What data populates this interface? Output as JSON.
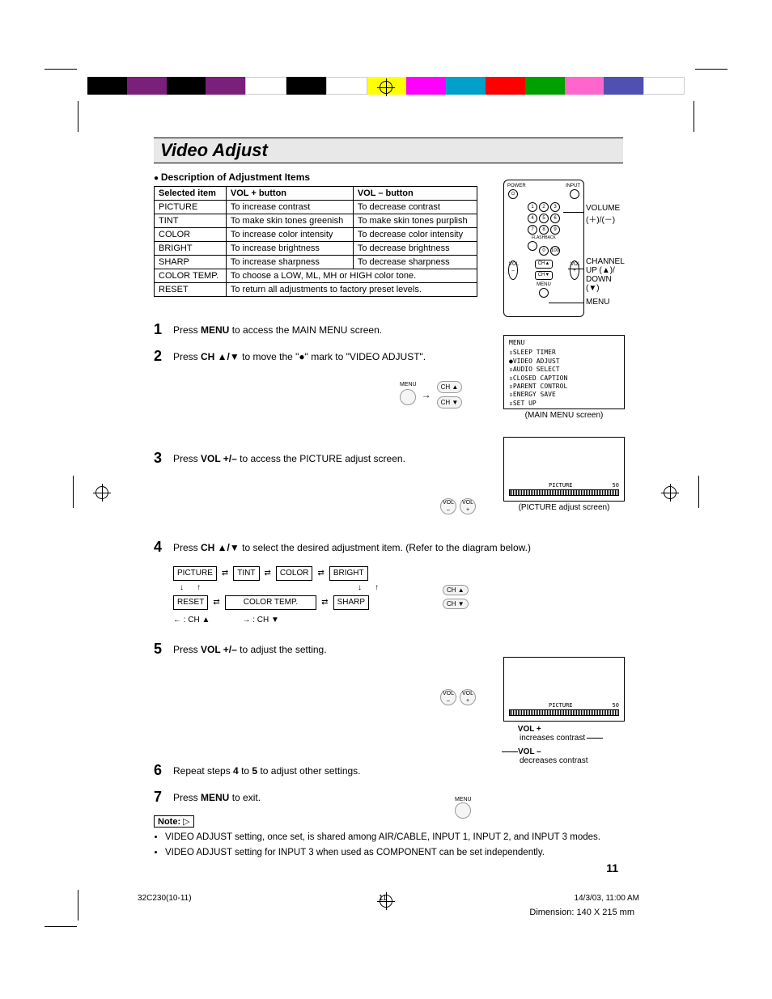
{
  "title": "Video Adjust",
  "subhead": "Description of Adjustment Items",
  "table": {
    "headers": [
      "Selected item",
      "VOL + button",
      "VOL – button"
    ],
    "rows": [
      [
        "PICTURE",
        "To increase contrast",
        "To decrease contrast"
      ],
      [
        "TINT",
        "To make skin tones greenish",
        "To make skin tones purplish"
      ],
      [
        "COLOR",
        "To increase color intensity",
        "To decrease color intensity"
      ],
      [
        "BRIGHT",
        "To increase brightness",
        "To decrease brightness"
      ],
      [
        "SHARP",
        "To increase sharpness",
        "To decrease sharpness"
      ]
    ],
    "span_rows": [
      [
        "COLOR TEMP.",
        "To choose a LOW, ML, MH or HIGH color tone."
      ],
      [
        "RESET",
        "To return all adjustments to factory preset levels."
      ]
    ]
  },
  "remote_labels": {
    "volume": "VOLUME\n(＋)/(－)",
    "channel": "CHANNEL\nUP (▲)/\nDOWN (▼)",
    "menu": "MENU",
    "power": "POWER",
    "input": "INPUT",
    "flashback": "FLASHBACK"
  },
  "steps": {
    "s1_a": "Press ",
    "s1_b": "MENU",
    "s1_c": " to access the MAIN MENU screen.",
    "s2_a": "Press ",
    "s2_b": "CH ▲/▼",
    "s2_c": " to move the \"●\" mark to \"VIDEO ADJUST\".",
    "s3_a": "Press ",
    "s3_b": "VOL +/–",
    "s3_c": " to access the PICTURE adjust screen.",
    "s4_a": "Press ",
    "s4_b": "CH ▲/▼",
    "s4_c": " to select the desired adjustment item. (Refer to the diagram below.)",
    "s5_a": "Press ",
    "s5_b": "VOL +/–",
    "s5_c": " to adjust the setting.",
    "s6_a": "Repeat steps ",
    "s6_b": "4",
    "s6_c": " to ",
    "s6_d": "5",
    "s6_e": " to adjust other settings.",
    "s7_a": "Press ",
    "s7_b": "MENU",
    "s7_c": " to exit."
  },
  "menu_screen": {
    "title": "MENU",
    "items": [
      "SLEEP TIMER",
      "VIDEO ADJUST",
      "AUDIO SELECT",
      "CLOSED CAPTION",
      "PARENT CONTROL",
      "ENERGY SAVE",
      "SET UP"
    ],
    "caption": "(MAIN MENU screen)"
  },
  "picture_screen": {
    "label": "PICTURE",
    "value": "50",
    "caption": "(PICTURE adjust screen)"
  },
  "flow": {
    "row1": [
      "PICTURE",
      "TINT",
      "COLOR",
      "BRIGHT"
    ],
    "row2_left": "RESET",
    "row2_mid": "COLOR TEMP.",
    "row2_right": "SHARP",
    "legend_left": "← : CH ▲",
    "legend_right": "→ : CH ▼"
  },
  "adjust_labels": {
    "vol_plus": "VOL +",
    "vol_plus_desc": "increases contrast",
    "vol_minus": "VOL –",
    "vol_minus_desc": "decreases contrast"
  },
  "buttons": {
    "menu": "MENU",
    "ch_up": "CH ▲",
    "ch_dn": "CH ▼",
    "vol_m": "VOL\n–",
    "vol_p": "VOL\n+"
  },
  "note_label": "Note:",
  "notes": [
    "VIDEO ADJUST setting, once set, is shared among AIR/CABLE, INPUT 1, INPUT 2, and INPUT 3 modes.",
    "VIDEO ADJUST setting for INPUT 3 when used as COMPONENT can be set independently."
  ],
  "page_number": "11",
  "footer": {
    "doc": "32C230(10-11)",
    "page": "11",
    "date": "14/3/03, 11:00 AM"
  },
  "dimension": "Dimension: 140  X 215 mm",
  "colorbar": [
    "#000",
    "#7a1f7a",
    "#000",
    "#7a1f7a",
    "#fff",
    "#000",
    "#fff",
    "#ffff00",
    "#ff00ff",
    "#00a0c8",
    "#ff0000",
    "#00a000",
    "#ff66cc",
    "#5050b0",
    "#fff"
  ]
}
